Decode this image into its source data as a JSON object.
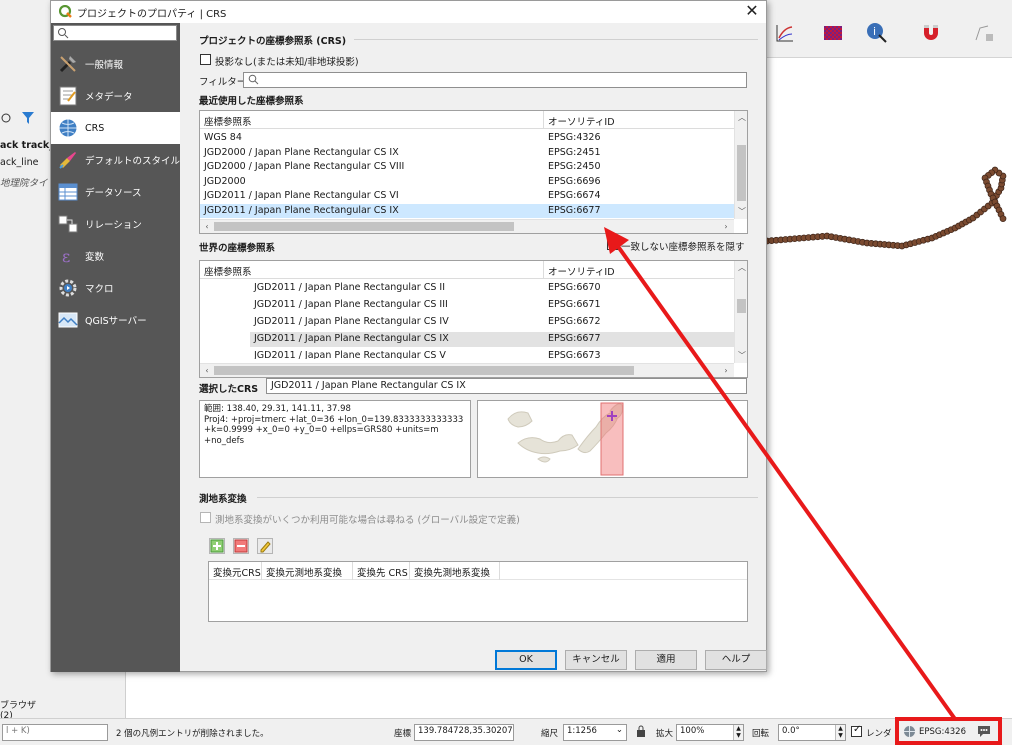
{
  "background": {
    "layers": {
      "layer1": "ack track_po",
      "layer2": "ack_line",
      "layer3": "地理院タイ"
    },
    "browser_tab": "ブラウザ (2)",
    "search_placeholder": "l + K)"
  },
  "statusbar": {
    "message": "2 個の凡例エントリが削除されました。",
    "coord_label": "座標",
    "coord_value": "139.784728,35.302072",
    "scale_label": "縮尺",
    "scale_value": "1:1256",
    "magnifier_label": "拡大",
    "magnifier_value": "100%",
    "rotation_label": "回転",
    "rotation_value": "0.0°",
    "render_label": "レンダ",
    "crs_value": "EPSG:4326"
  },
  "dialog": {
    "title": "プロジェクトのプロパティ | CRS",
    "close_symbol": "✕",
    "nav_items": [
      {
        "label": "一般情報"
      },
      {
        "label": "メタデータ"
      },
      {
        "label": "CRS"
      },
      {
        "label": "デフォルトのスタイル"
      },
      {
        "label": "データソース"
      },
      {
        "label": "リレーション"
      },
      {
        "label": "変数"
      },
      {
        "label": "マクロ"
      },
      {
        "label": "QGISサーバー"
      }
    ],
    "crs_group_title": "プロジェクトの座標参照系 (CRS)",
    "no_projection_label": "投影なし(または未知/非地球投影)",
    "filter_label": "フィルター",
    "recent_title": "最近使用した座標参照系",
    "recent_table": {
      "col1": "座標参照系",
      "col2": "オーソリティID",
      "rows": [
        {
          "name": "WGS 84",
          "authid": "EPSG:4326"
        },
        {
          "name": "JGD2000 / Japan Plane Rectangular CS IX",
          "authid": "EPSG:2451"
        },
        {
          "name": "JGD2000 / Japan Plane Rectangular CS VIII",
          "authid": "EPSG:2450"
        },
        {
          "name": "JGD2000",
          "authid": "EPSG:6696"
        },
        {
          "name": "JGD2011 / Japan Plane Rectangular CS VI",
          "authid": "EPSG:6674"
        },
        {
          "name": "JGD2011 / Japan Plane Rectangular CS IX",
          "authid": "EPSG:6677"
        }
      ]
    },
    "world_title": "世界の座標参照系",
    "hide_deprecated_label": "一致しない座標参照系を隠す",
    "world_table": {
      "col1": "座標参照系",
      "col2": "オーソリティID",
      "rows": [
        {
          "name": "JGD2011 / Japan Plane Rectangular CS II",
          "authid": "EPSG:6670"
        },
        {
          "name": "JGD2011 / Japan Plane Rectangular CS III",
          "authid": "EPSG:6671"
        },
        {
          "name": "JGD2011 / Japan Plane Rectangular CS IV",
          "authid": "EPSG:6672"
        },
        {
          "name": "JGD2011 / Japan Plane Rectangular CS IX",
          "authid": "EPSG:6677"
        },
        {
          "name": "JGD2011 / Japan Plane Rectangular CS V",
          "authid": "EPSG:6673"
        }
      ]
    },
    "selected_crs_label": "選択したCRS",
    "selected_crs_value": "JGD2011 / Japan Plane Rectangular CS IX",
    "crs_info": {
      "line1": "範囲: 138.40, 29.31, 141.11, 37.98",
      "line2": "Proj4: +proj=tmerc +lat_0=36 +lon_0=139.8333333333333",
      "line3": "+k=0.9999 +x_0=0 +y_0=0 +ellps=GRS80 +units=m +no_defs"
    },
    "datum_group_title": "測地系変換",
    "datum_ask_label": "測地系変換がいくつか利用可能な場合は尋ねる (グローバル設定で定義)",
    "datum_table_headers": [
      "変換元CRS",
      "変換元測地系変換",
      "変換先 CRS",
      "変換先測地系変換"
    ],
    "buttons": {
      "ok": "OK",
      "cancel": "キャンセル",
      "apply": "適用",
      "help": "ヘルプ"
    }
  },
  "colors": {
    "annotation_red": "#e8191a",
    "nav_bg": "#565656",
    "selection_blue": "#cde8ff",
    "track_brown": "#7a4a30"
  }
}
